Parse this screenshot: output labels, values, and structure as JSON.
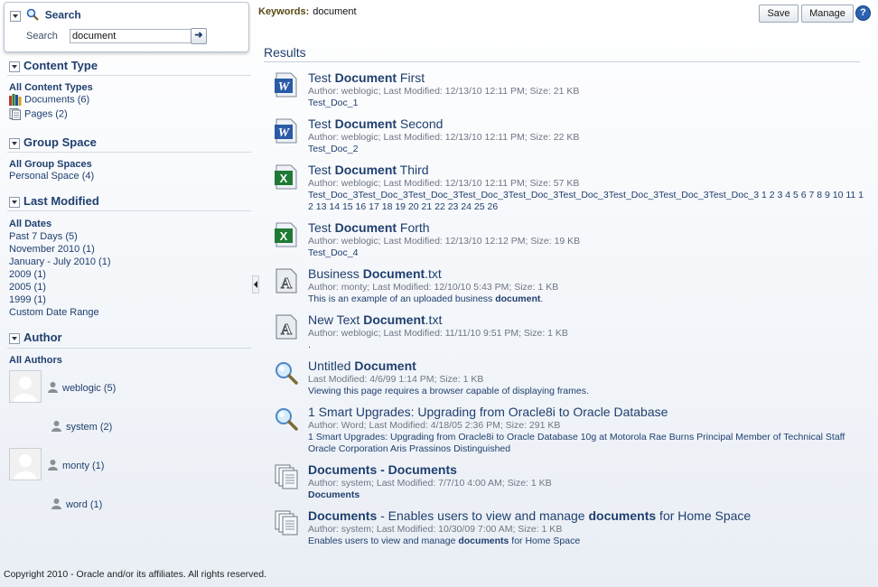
{
  "search": {
    "title": "Search",
    "label": "Search",
    "value": "document",
    "go_symbol": "➜"
  },
  "facets": {
    "content_type": {
      "heading": "Content Type",
      "all": "All Content Types",
      "items": [
        "Documents (6)",
        "Pages (2)"
      ]
    },
    "group_space": {
      "heading": "Group Space",
      "all": "All Group Spaces",
      "items": [
        "Personal Space (4)"
      ]
    },
    "last_modified": {
      "heading": "Last Modified",
      "all": "All Dates",
      "items": [
        "Past 7 Days (5)",
        "November 2010 (1)",
        "January - July 2010 (1)",
        "2009 (1)",
        "2005 (1)",
        "1999 (1)",
        "Custom Date Range"
      ]
    },
    "author": {
      "heading": "Author",
      "all": "All Authors",
      "items": [
        "weblogic (5)",
        "system (2)",
        "monty (1)",
        "word (1)"
      ]
    }
  },
  "keywords": {
    "label": "Keywords:",
    "value": "document"
  },
  "toolbar": {
    "save": "Save",
    "manage": "Manage",
    "help": "?"
  },
  "results_heading": "Results",
  "results": [
    {
      "icon": "word-doc-icon",
      "title_pre": "Test ",
      "title_bold": "Document",
      "title_post": " First",
      "meta": "Author:  weblogic;  Last Modified:  12/13/10 12:11 PM;  Size:  21 KB",
      "snippet": "Test_Doc_1"
    },
    {
      "icon": "word-doc-icon",
      "title_pre": "Test ",
      "title_bold": "Document",
      "title_post": " Second",
      "meta": "Author:  weblogic;  Last Modified:  12/13/10 12:11 PM;  Size:  22 KB",
      "snippet": "Test_Doc_2"
    },
    {
      "icon": "excel-doc-icon",
      "title_pre": "Test ",
      "title_bold": "Document",
      "title_post": " Third",
      "meta": "Author:  weblogic;  Last Modified:  12/13/10 12:11 PM;  Size:  57 KB",
      "snippet": "Test_Doc_3Test_Doc_3Test_Doc_3Test_Doc_3Test_Doc_3Test_Doc_3Test_Doc_3Test_Doc_3Test_Doc_3 1 2 3 4 5 6 7 8 9 10 11 12 13 14 15 16 17 18 19 20 21 22 23 24 25 26"
    },
    {
      "icon": "excel-doc-icon",
      "title_pre": "Test ",
      "title_bold": "Document",
      "title_post": " Forth",
      "meta": "Author:  weblogic;  Last Modified:  12/13/10 12:12 PM;  Size:  19 KB",
      "snippet": "Test_Doc_4"
    },
    {
      "icon": "text-doc-icon",
      "title_pre": "Business ",
      "title_bold": "Document",
      "title_post": ".txt",
      "meta": "Author:  monty;  Last Modified:  12/10/10 5:43 PM;  Size:  1 KB",
      "snippet_pre": "This is an example of an uploaded business ",
      "snippet_bold": "document",
      "snippet_post": "."
    },
    {
      "icon": "text-doc-icon",
      "title_pre": "New Text ",
      "title_bold": "Document",
      "title_post": ".txt",
      "meta": "Author:  weblogic;  Last Modified:  11/11/10 9:51 PM;  Size:  1 KB",
      "snippet": "."
    },
    {
      "icon": "magnifier-icon",
      "title_pre": "Untitled ",
      "title_bold": "Document",
      "title_post": "",
      "meta": "Last Modified:  4/6/99 1:14 PM;  Size:  1 KB",
      "snippet": "Viewing this page requires a browser capable of displaying frames."
    },
    {
      "icon": "magnifier-icon",
      "title_pre": "1 Smart Upgrades: Upgrading from Oracle8i to Oracle Database",
      "title_bold": "",
      "title_post": "",
      "meta": "Author:  Word;  Last Modified:  4/18/05 2:36 PM;  Size:  291 KB",
      "snippet": "1 Smart Upgrades: Upgrading from Oracle8i to Oracle Database 10g at Motorola Rae Burns Principal Member of Technical Staff Oracle Corporation Aris Prassinos Distinguished"
    },
    {
      "icon": "pages-icon",
      "title_pre": "",
      "title_bold": "Documents - Documents",
      "title_post": "",
      "meta": "Author:  system;  Last Modified:  7/7/10 4:00 AM;  Size:  1 KB",
      "snippet_pre": "",
      "snippet_bold": "Documents",
      "snippet_post": ""
    },
    {
      "icon": "pages-icon",
      "title_pre": "",
      "title_bold": "Documents",
      "title_post": " - Enables users to view and manage ",
      "title_bold2": "documents",
      "title_post2": " for Home Space",
      "meta": "Author:  system;  Last Modified:  10/30/09 7:00 AM;  Size:  1 KB",
      "snippet_pre": "Enables users to view and manage ",
      "snippet_bold": "documents",
      "snippet_post": " for Home Space"
    }
  ],
  "footer": "Copyright 2010 - Oracle and/or its affiliates. All rights reserved."
}
